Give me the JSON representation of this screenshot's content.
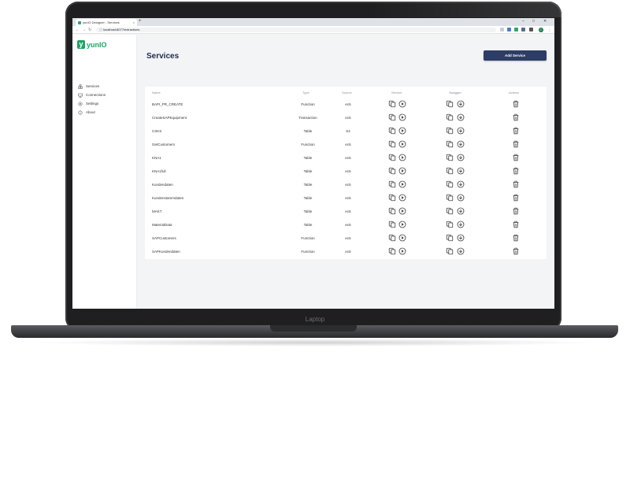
{
  "device": {
    "label": "Laptop"
  },
  "browser": {
    "tab_title": "yunIO Designer - Services",
    "tab_close": "×",
    "new_tab": "+",
    "window_controls": [
      "–",
      "□",
      "✕"
    ],
    "url": "localhost:8077/extractions",
    "profile_initial": "C"
  },
  "app": {
    "logo_text": "yunIO",
    "logo_mark": "y",
    "brand_color": "#1ea466",
    "accent_color": "#2d3d66"
  },
  "sidebar": {
    "items": [
      {
        "label": "Services",
        "icon": "services-icon"
      },
      {
        "label": "Connections",
        "icon": "connections-icon"
      },
      {
        "label": "Settings",
        "icon": "settings-icon"
      },
      {
        "label": "About",
        "icon": "info-icon"
      }
    ]
  },
  "main": {
    "title": "Services",
    "add_button": "Add Service"
  },
  "table": {
    "headers": {
      "name": "Name",
      "type": "Type",
      "source": "Source",
      "service": "Service",
      "swagger": "Swagger",
      "actions": "Actions"
    },
    "rows": [
      {
        "name": "BAPI_PR_CREATE",
        "type": "Function",
        "source": "ec5"
      },
      {
        "name": "CreateSAPEquipment",
        "type": "Transaction",
        "source": "ec5"
      },
      {
        "name": "CSKS",
        "type": "Table",
        "source": "S4"
      },
      {
        "name": "GetCustomers",
        "type": "Function",
        "source": "ec5"
      },
      {
        "name": "KNA1",
        "type": "Table",
        "source": "ec5"
      },
      {
        "name": "KNA1full",
        "type": "Table",
        "source": "ec5"
      },
      {
        "name": "Kundendaten",
        "type": "Table",
        "source": "ec5"
      },
      {
        "name": "Kundenstammdaten",
        "type": "Table",
        "source": "ec5"
      },
      {
        "name": "MAKT",
        "type": "Table",
        "source": "ec5"
      },
      {
        "name": "MaterialData",
        "type": "Table",
        "source": "ec5"
      },
      {
        "name": "SAPCustomers",
        "type": "Function",
        "source": "ec5"
      },
      {
        "name": "SAPKundendaten",
        "type": "Function",
        "source": "ec5"
      }
    ],
    "row_icons": {
      "service": [
        "copy-icon",
        "play-icon"
      ],
      "swagger": [
        "copy-icon",
        "download-icon"
      ],
      "actions": [
        "trash-icon"
      ]
    }
  }
}
